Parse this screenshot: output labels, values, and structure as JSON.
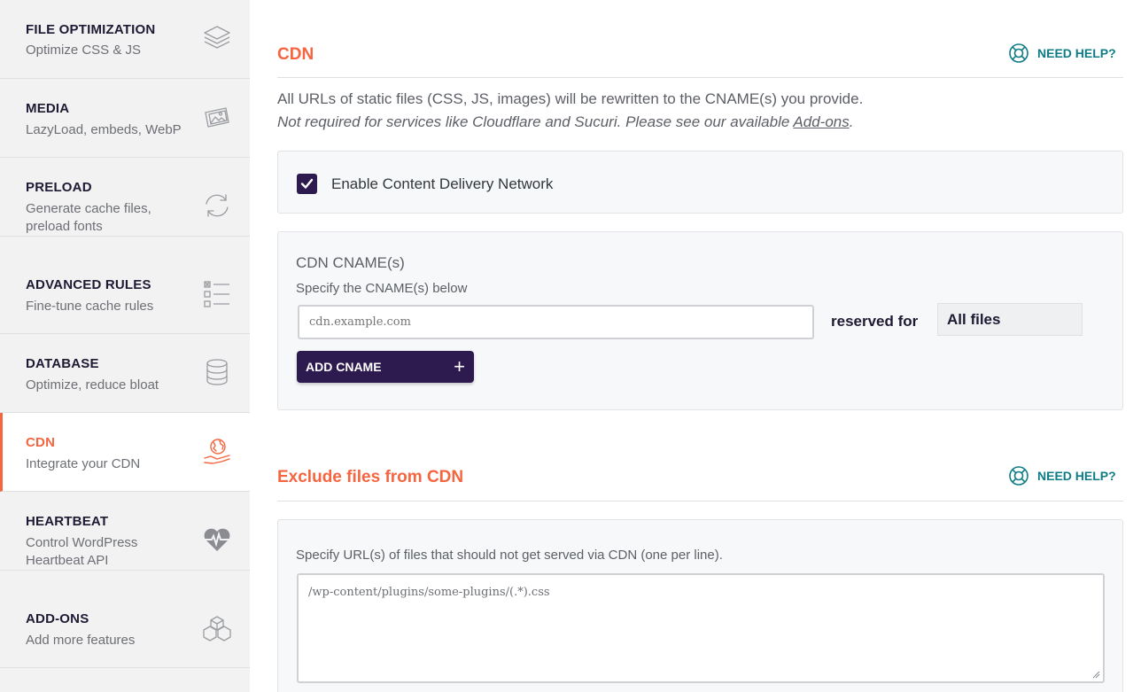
{
  "sidebar": {
    "items": [
      {
        "title": "FILE OPTIMIZATION",
        "subtitle": "Optimize CSS & JS",
        "icon": "layers-icon"
      },
      {
        "title": "MEDIA",
        "subtitle": "LazyLoad, embeds, WebP",
        "icon": "images-icon"
      },
      {
        "title": "PRELOAD",
        "subtitle": "Generate cache files, preload fonts",
        "icon": "refresh-icon"
      },
      {
        "title": "ADVANCED RULES",
        "subtitle": "Fine-tune cache rules",
        "icon": "checklist-icon"
      },
      {
        "title": "DATABASE",
        "subtitle": "Optimize, reduce bloat",
        "icon": "database-icon"
      },
      {
        "title": "CDN",
        "subtitle": "Integrate your CDN",
        "icon": "globe-hand-icon",
        "active": true
      },
      {
        "title": "HEARTBEAT",
        "subtitle": "Control WordPress Heartbeat API",
        "icon": "heartbeat-icon"
      },
      {
        "title": "ADD-ONS",
        "subtitle": "Add more features",
        "icon": "cubes-icon"
      }
    ]
  },
  "cdn": {
    "title": "CDN",
    "help_label": "NEED HELP?",
    "desc_line1": "All URLs of static files (CSS, JS, images) will be rewritten to the CNAME(s) you provide.",
    "desc_line2": "Not required for services like Cloudflare and Sucuri. Please see our available ",
    "desc_link": "Add-ons",
    "desc_end": ".",
    "enable_label": "Enable Content Delivery Network",
    "enable_checked": true,
    "cname_title": "CDN CNAME(s)",
    "cname_help": "Specify the CNAME(s) below",
    "cname_placeholder": "cdn.example.com",
    "reserved_label": "reserved for",
    "reserved_value": "All files",
    "add_button": "ADD CNAME"
  },
  "exclude": {
    "title": "Exclude files from CDN",
    "help_label": "NEED HELP?",
    "field_help": "Specify URL(s) of files that should not get served via CDN (one per line).",
    "placeholder": "/wp-content/plugins/some-plugins/(.*).css"
  },
  "colors": {
    "accent": "#f56640",
    "brand": "#2d1a4e",
    "help": "#0e7c86"
  }
}
